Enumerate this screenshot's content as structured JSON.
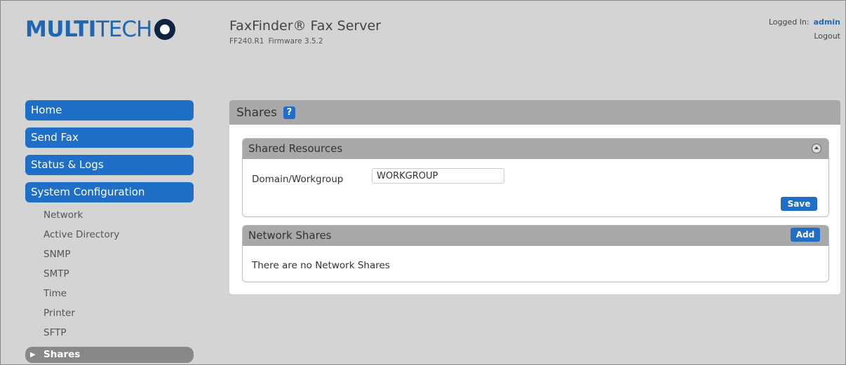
{
  "header": {
    "logo_bold": "MULTI",
    "logo_light": "TECH",
    "title": "FaxFinder® Fax Server",
    "model": "FF240.R1",
    "firmware": "Firmware 3.5.2",
    "logged_in_label": "Logged In:",
    "user": "admin",
    "logout": "Logout"
  },
  "sidebar": {
    "main_items": [
      {
        "label": "Home"
      },
      {
        "label": "Send Fax"
      },
      {
        "label": "Status & Logs"
      },
      {
        "label": "System Configuration"
      }
    ],
    "sub_items": [
      {
        "label": "Network"
      },
      {
        "label": "Active Directory"
      },
      {
        "label": "SNMP"
      },
      {
        "label": "SMTP"
      },
      {
        "label": "Time"
      },
      {
        "label": "Printer"
      },
      {
        "label": "SFTP"
      }
    ],
    "active_item": "Shares"
  },
  "main": {
    "title": "Shares",
    "help_label": "?",
    "shared_resources": {
      "title": "Shared Resources",
      "domain_label": "Domain/Workgroup",
      "domain_value": "WORKGROUP",
      "save_label": "Save"
    },
    "network_shares": {
      "title": "Network Shares",
      "add_label": "Add",
      "empty_message": "There are no Network Shares"
    }
  },
  "colors": {
    "accent": "#1f6fc8",
    "background": "#d4d4d4",
    "header_gray": "#a8a8a8"
  }
}
